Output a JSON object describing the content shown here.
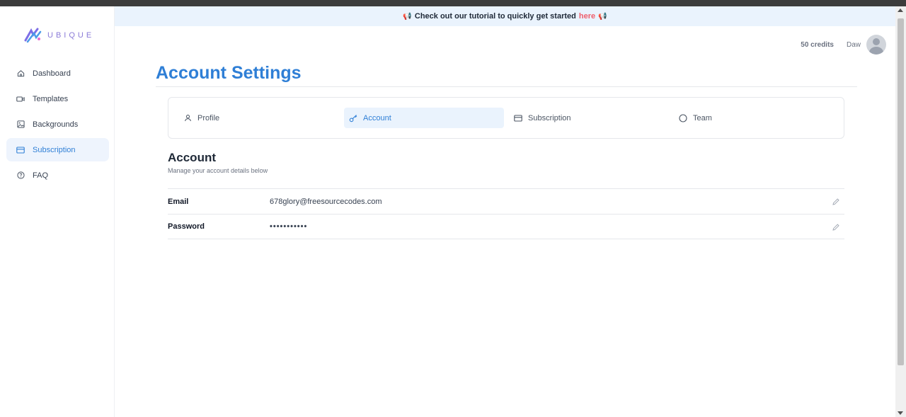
{
  "brand": {
    "name": "UBIQUE"
  },
  "sidebar": {
    "items": [
      {
        "label": "Dashboard",
        "icon": "home-icon"
      },
      {
        "label": "Templates",
        "icon": "video-icon"
      },
      {
        "label": "Backgrounds",
        "icon": "image-icon"
      },
      {
        "label": "Subscription",
        "icon": "credit-card-icon",
        "active": true
      },
      {
        "label": "FAQ",
        "icon": "help-circle-icon"
      }
    ]
  },
  "banner": {
    "text": "Check out our tutorial to quickly get started",
    "link": "here",
    "icon": "megaphone-icon"
  },
  "header": {
    "credits": "50 credits",
    "username": "Daw"
  },
  "page": {
    "title": "Account Settings"
  },
  "tabs": [
    {
      "label": "Profile",
      "icon": "user-icon"
    },
    {
      "label": "Account",
      "icon": "key-icon",
      "active": true
    },
    {
      "label": "Subscription",
      "icon": "credit-card-icon"
    },
    {
      "label": "Team",
      "icon": "circle-icon"
    }
  ],
  "section": {
    "title": "Account",
    "subtitle": "Manage your account details below"
  },
  "fields": [
    {
      "label": "Email",
      "value": "678glory@freesourcecodes.com"
    },
    {
      "label": "Password",
      "value": "•••••••••••"
    }
  ],
  "colors": {
    "accent": "#2f7fd6",
    "banner_bg": "#eaf3fd",
    "link": "#ef5f6c",
    "active_bg": "#eef4fd"
  }
}
